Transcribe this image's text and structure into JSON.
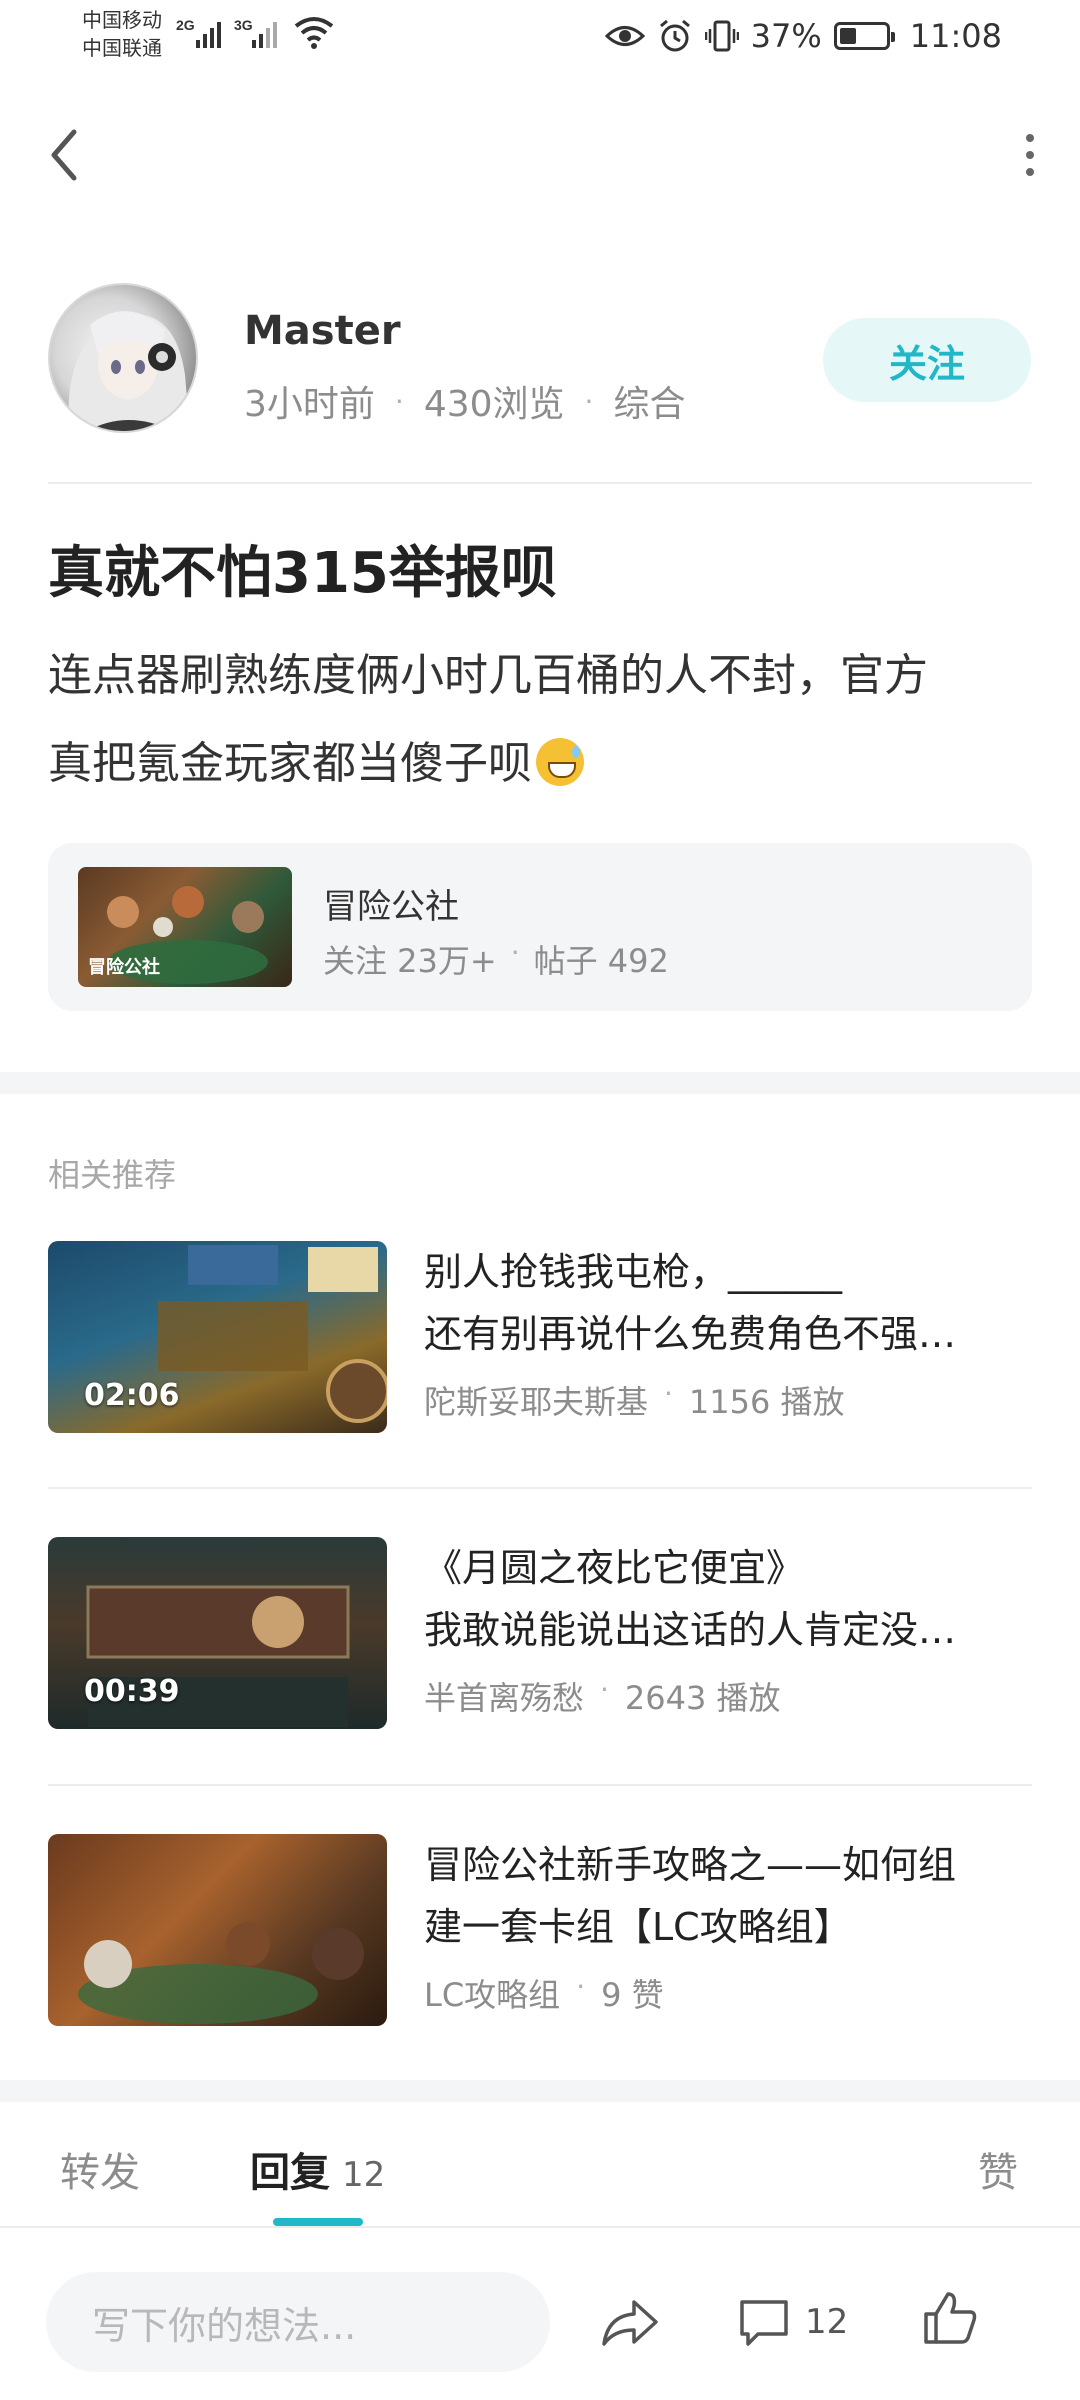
{
  "status_bar": {
    "carrier1": "中国移动",
    "carrier2": "中国联通",
    "net1": "2G",
    "net2": "3G",
    "battery_percent": "37%",
    "battery_level": 0.37,
    "time": "11:08"
  },
  "author": {
    "name": "Master",
    "time_ago": "3小时前",
    "views": "430浏览",
    "category": "综合",
    "follow_label": "关注"
  },
  "post": {
    "title": "真就不怕315举报呗",
    "body_line1": "连点器刷熟练度俩小时几百桶的人不封，官方",
    "body_line2": "真把氪金玩家都当傻子呗"
  },
  "community": {
    "name": "冒险公社",
    "followers": "关注 23万+",
    "posts": "帖子 492",
    "logo_text": "冒险公社"
  },
  "related": {
    "heading": "相关推荐",
    "items": [
      {
        "title_line1": "别人抢钱我屯枪，______",
        "title_line2": "还有别再说什么免费角色不强…",
        "author": "陀斯妥耶夫斯基",
        "stat": "1156 播放",
        "duration": "02:06"
      },
      {
        "title_line1": "《月圆之夜比它便宜》",
        "title_line2": "我敢说能说出这话的人肯定没…",
        "author": "半首离殇愁",
        "stat": "2643 播放",
        "duration": "00:39"
      },
      {
        "title_line1": "冒险公社新手攻略之——如何组",
        "title_line2": "建一套卡组【LC攻略组】",
        "author": "LC攻略组",
        "stat": "9 赞",
        "duration": ""
      }
    ]
  },
  "tabs": {
    "forward": "转发",
    "reply": "回复",
    "reply_count": "12",
    "like": "赞"
  },
  "bottom_bar": {
    "input_placeholder": "写下你的想法...",
    "comment_count": "12"
  },
  "colors": {
    "accent": "#20b7c8",
    "follow_bg": "#e6f7f8"
  }
}
